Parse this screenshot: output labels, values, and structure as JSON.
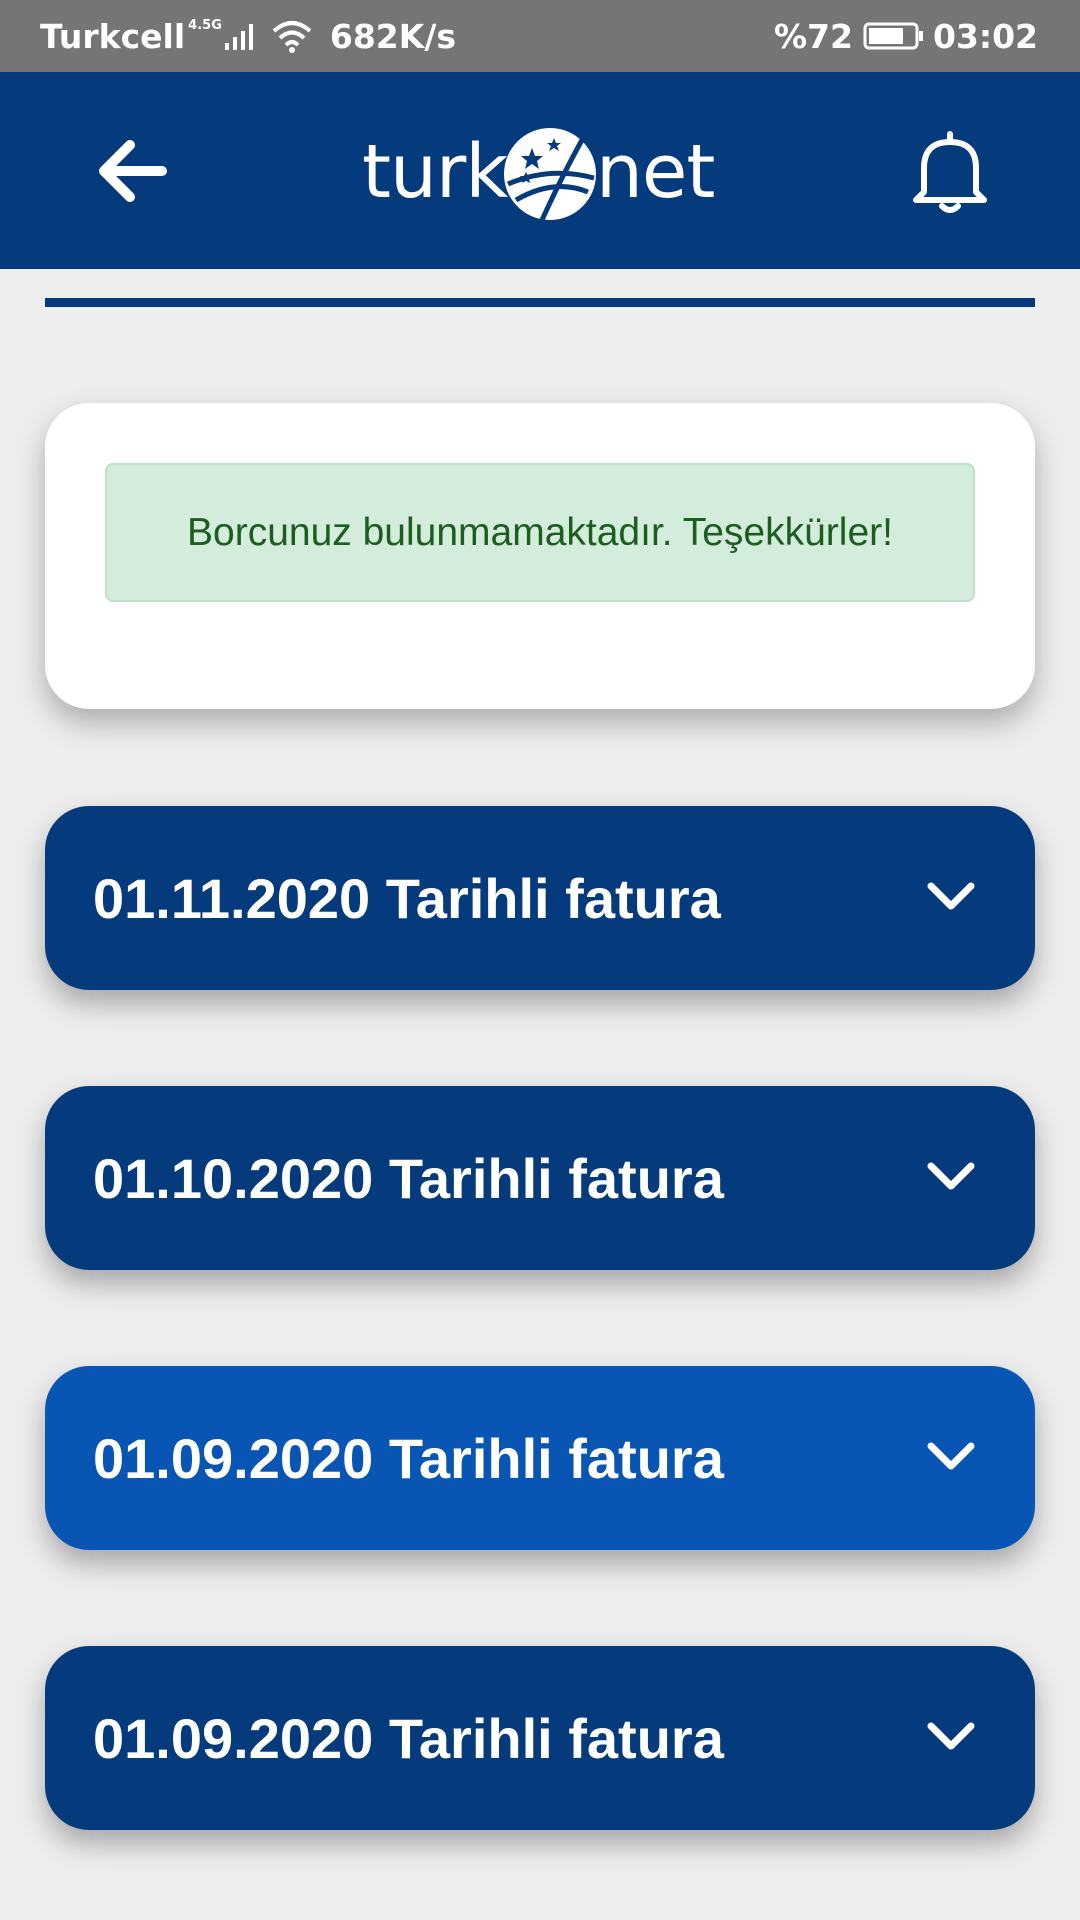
{
  "status_bar": {
    "carrier": "Turkcell",
    "network_type": "4.5G",
    "speed": "682K/s",
    "battery": "%72",
    "time": "03:02"
  },
  "app_bar": {
    "back_icon": "arrow-left-icon",
    "logo_left": "turk",
    "logo_right": "net",
    "notification_icon": "bell-icon"
  },
  "notice": {
    "message": "Borcunuz bulunmamaktadır. Teşekkürler!"
  },
  "invoices": [
    {
      "label": "01.11.2020 Tarihli fatura"
    },
    {
      "label": "01.10.2020 Tarihli fatura"
    },
    {
      "label": "01.09.2020 Tarihli fatura"
    },
    {
      "label": "01.09.2020 Tarihli fatura"
    }
  ],
  "colors": {
    "primary": "#053b7c",
    "primary_active": "#0855b3",
    "success_bg": "#d4ecdb",
    "success_text": "#1b5e20",
    "status_bar": "#757575"
  }
}
